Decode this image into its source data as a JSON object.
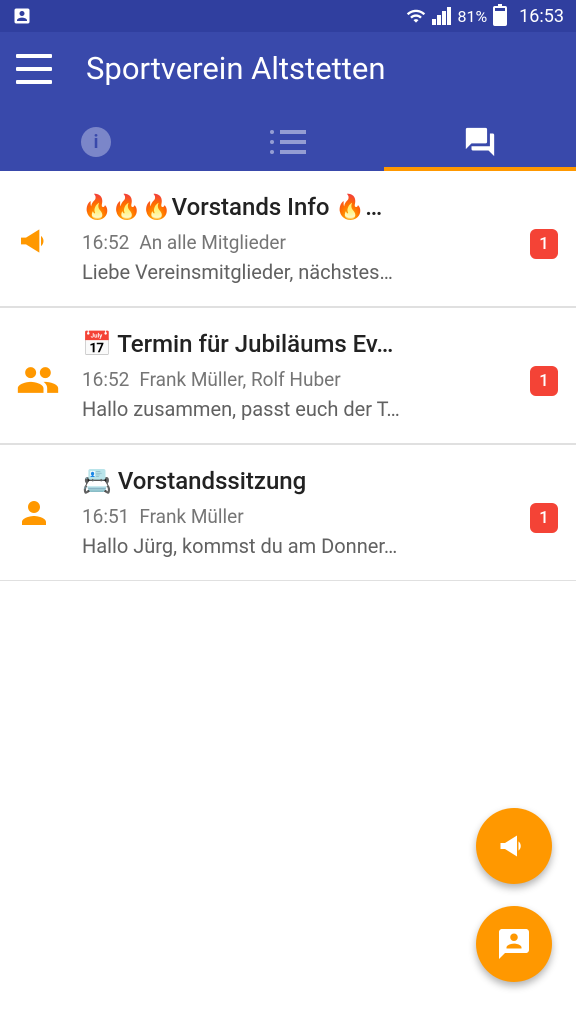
{
  "status": {
    "battery_pct": "81%",
    "time": "16:53"
  },
  "header": {
    "title": "Sportverein Altstetten"
  },
  "conversations": [
    {
      "icon": "megaphone",
      "title": "🔥🔥🔥Vorstands Info 🔥…",
      "time": "16:52",
      "participants": "An alle Mitglieder",
      "preview": "Liebe Vereinsmitglieder, nächstes…",
      "badge": "1"
    },
    {
      "icon": "group",
      "title": "📅 Termin für Jubiläums Ev…",
      "time": "16:52",
      "participants": "Frank Müller, Rolf Huber",
      "preview": "Hallo zusammen, passt euch der T…",
      "badge": "1"
    },
    {
      "icon": "person",
      "title": "📇 Vorstandssitzung",
      "time": "16:51",
      "participants": "Frank Müller",
      "preview": "Hallo Jürg, kommst du am Donner…",
      "badge": "1"
    }
  ],
  "fabs": {
    "broadcast": "megaphone",
    "message": "contact-chat"
  }
}
